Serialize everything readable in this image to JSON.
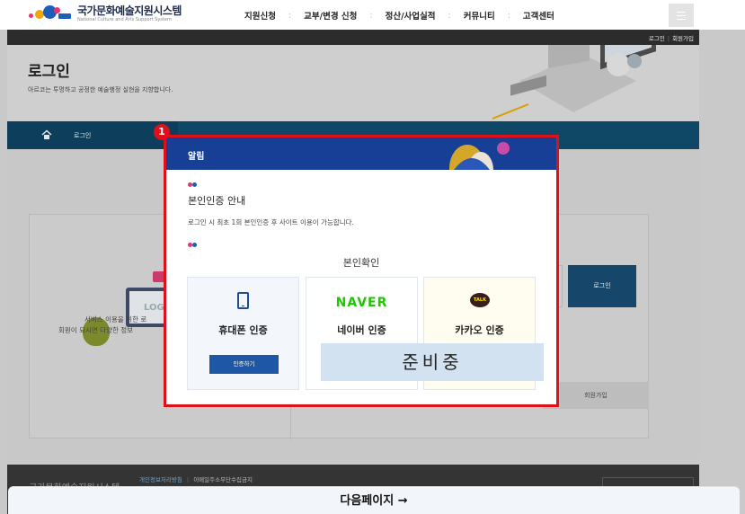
{
  "header": {
    "logo_ko": "국가문화예술지원시스템",
    "logo_en": "National Culture and Arts Support System",
    "nav": [
      "지원신청",
      "교부/변경 신청",
      "정산/사업실적",
      "커뮤니티",
      "고객센터"
    ]
  },
  "topbar": {
    "login": "로그인",
    "join": "회원가입"
  },
  "hero": {
    "title": "로그인",
    "subtitle": "아르코는 투명하고 공정한 예술행정 실현을 지향합니다."
  },
  "breadcrumb": {
    "current": "로그인"
  },
  "background": {
    "login_button": "로그인",
    "join_button": "회원가입",
    "monitor_text": "LOG",
    "service_text_1": "서비스 이용을 위한 로",
    "service_text_2": "회원이 되시면 다양한 정보"
  },
  "footer": {
    "brand": "국가문화예술지원시스템",
    "privacy": "개인정보처리방침",
    "email_policy": "이메일주소무단수집금지"
  },
  "annotation": {
    "badge": "1"
  },
  "modal": {
    "title": "알림",
    "section_title": "본인인증 안내",
    "section_desc": "로그인 시 최초 1회 본인인증 후 사이트 이용이 가능합니다.",
    "verify_title": "본인확인",
    "cards": {
      "phone": {
        "name": "휴대폰 인증",
        "button": "인증하기"
      },
      "naver": {
        "logo": "NAVER",
        "name": "네이버 인증"
      },
      "kakao": {
        "logo": "TALK",
        "name": "카카오 인증"
      }
    },
    "preparing": "준비중"
  },
  "next_page": "다음페이지 →",
  "colors": {
    "modal_header": "#173f95",
    "highlight": "#e0101a",
    "naver_green": "#1ec800",
    "kakao_brown": "#3a1d1d",
    "verify_button": "#1d57a6"
  }
}
